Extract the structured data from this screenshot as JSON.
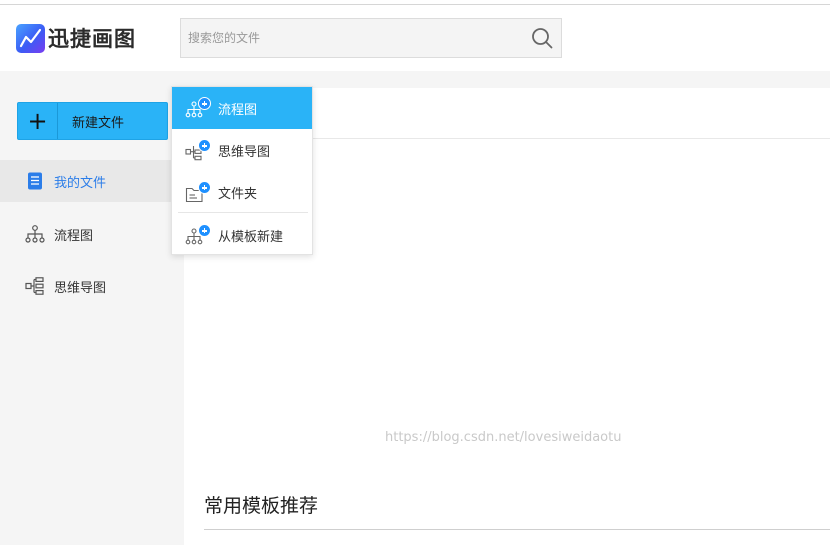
{
  "app": {
    "brand_name": "迅捷画图",
    "accent_color": "#2ab3f7",
    "active_text_color": "#2b7de9"
  },
  "search": {
    "placeholder": "搜索您的文件",
    "icon": "search-icon"
  },
  "sidebar": {
    "new_button_label": "新建文件",
    "new_button_icon": "plus-icon",
    "items": [
      {
        "label": "我的文件",
        "icon": "document-icon",
        "active": true
      },
      {
        "label": "流程图",
        "icon": "flowchart-icon",
        "active": false
      },
      {
        "label": "思维导图",
        "icon": "mindmap-icon",
        "active": false
      }
    ]
  },
  "dropdown": {
    "items": [
      {
        "label": "流程图",
        "icon": "flowchart-add-icon",
        "active": true
      },
      {
        "label": "思维导图",
        "icon": "mindmap-add-icon",
        "active": false
      },
      {
        "label": "文件夹",
        "icon": "folder-add-icon",
        "active": false
      },
      {
        "label": "从模板新建",
        "icon": "template-add-icon",
        "active": false
      }
    ]
  },
  "main": {
    "section_title": "常用模板推荐"
  },
  "watermark": "https://blog.csdn.net/lovesiweidaotu"
}
